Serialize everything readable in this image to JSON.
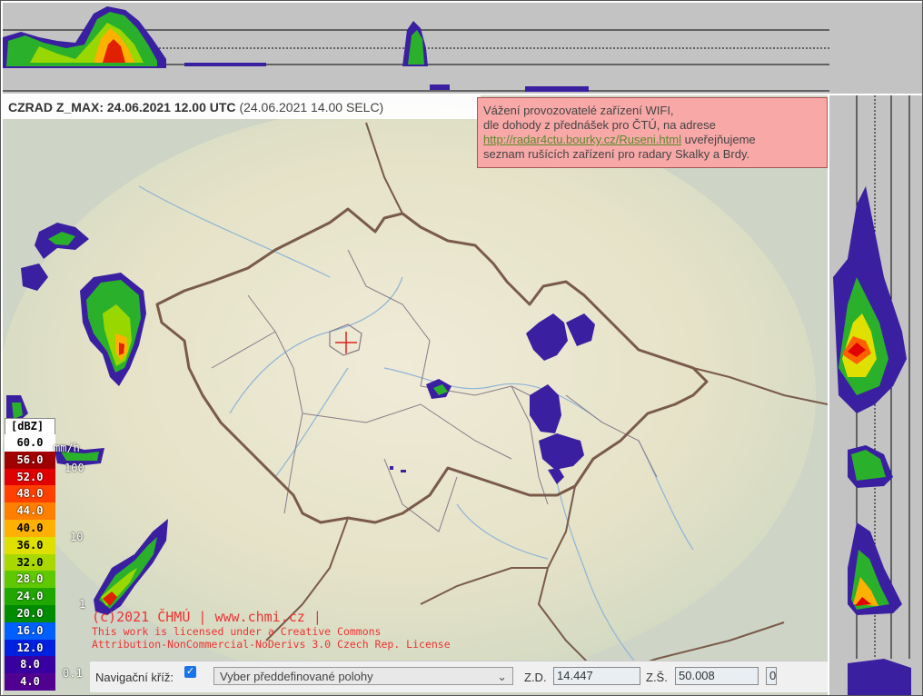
{
  "title": {
    "main": "CZRAD Z_MAX: 24.06.2021 12.00 UTC",
    "local": "(24.06.2021 14.00 SELC)"
  },
  "notice": {
    "line1": "Vážení provozovatelé zařízení WIFI,",
    "line2": "dle dohody z přednášek pro ČTÚ, na adrese",
    "link": "http://radar4ctu.bourky.cz/Ruseni.html",
    "after_link": "uveřejňujeme",
    "line4": "seznam rušících zařízení pro radary Skalky a Brdy."
  },
  "legend": {
    "unit": "[dBZ]",
    "rows": [
      {
        "label": "60.0",
        "color": "#ffffff"
      },
      {
        "label": "56.0",
        "color": "#a00000"
      },
      {
        "label": "52.0",
        "color": "#e00000"
      },
      {
        "label": "48.0",
        "color": "#ff4000"
      },
      {
        "label": "44.0",
        "color": "#ff8000"
      },
      {
        "label": "40.0",
        "color": "#ffb000"
      },
      {
        "label": "36.0",
        "color": "#e0e000"
      },
      {
        "label": "32.0",
        "color": "#a8d800"
      },
      {
        "label": "28.0",
        "color": "#60c800"
      },
      {
        "label": "24.0",
        "color": "#20a800"
      },
      {
        "label": "20.0",
        "color": "#008c00"
      },
      {
        "label": "16.0",
        "color": "#0060ff"
      },
      {
        "label": "12.0",
        "color": "#0020e0"
      },
      {
        "label": "8.0",
        "color": "#3800a0"
      },
      {
        "label": "4.0",
        "color": "#500090"
      }
    ],
    "rain_unit": "mm/h",
    "rain_ticks": [
      "100",
      "10",
      "1",
      "0.1"
    ]
  },
  "copyright": {
    "line1": "(c)2021 ČHMÚ | www.chmi.cz |",
    "line2": "This work is licensed under a Creative Commons",
    "line3": "Attribution-NonCommercial-NoDerivs 3.0 Czech Rep. License"
  },
  "nav": {
    "label": "Navigační kříž:",
    "checked": true,
    "select_value": "Vyber předdefinované polohy",
    "zd_label": "Z.D.",
    "zd_value": "14.447",
    "zs_label": "Z.Š.",
    "zs_value": "50.008",
    "extra_value": "0"
  }
}
